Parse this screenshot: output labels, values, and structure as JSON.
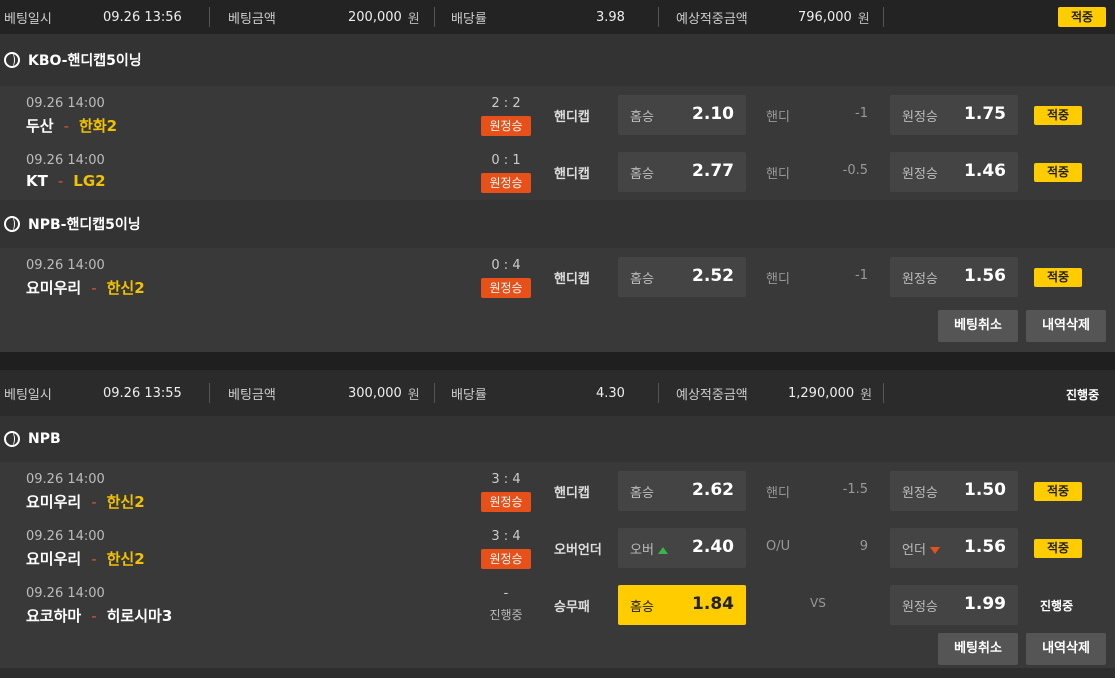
{
  "slip1": {
    "header": {
      "date_label": "베팅일시",
      "date": "09.26 13:56",
      "amount_label": "베팅금액",
      "amount": "200,000",
      "unit": "원",
      "odds_label": "배당률",
      "odds": "3.98",
      "expected_label": "예상적중금액",
      "expected": "796,000",
      "status": "적중"
    },
    "leagues": [
      {
        "name": "KBO-핸디캡5이닝",
        "games": [
          {
            "time": "09.26 14:00",
            "home": "두산",
            "away": "한화2",
            "score": "2 : 2",
            "badge": "원정승",
            "market": "핸디캡",
            "b1_label": "홈승",
            "b1_odds": "2.10",
            "mid_label": "핸디",
            "mid_val": "-1",
            "b3_label": "원정승",
            "b3_odds": "1.75",
            "result": "적중"
          },
          {
            "time": "09.26 14:00",
            "home": "KT",
            "away": "LG2",
            "score": "0 : 1",
            "badge": "원정승",
            "market": "핸디캡",
            "b1_label": "홈승",
            "b1_odds": "2.77",
            "mid_label": "핸디",
            "mid_val": "-0.5",
            "b3_label": "원정승",
            "b3_odds": "1.46",
            "result": "적중"
          }
        ]
      },
      {
        "name": "NPB-핸디캡5이닝",
        "games": [
          {
            "time": "09.26 14:00",
            "home": "요미우리",
            "away": "한신2",
            "score": "0 : 4",
            "badge": "원정승",
            "market": "핸디캡",
            "b1_label": "홈승",
            "b1_odds": "2.52",
            "mid_label": "핸디",
            "mid_val": "-1",
            "b3_label": "원정승",
            "b3_odds": "1.56",
            "result": "적중"
          }
        ]
      }
    ],
    "cancel_btn": "베팅취소",
    "delete_btn": "내역삭제"
  },
  "slip2": {
    "header": {
      "date_label": "베팅일시",
      "date": "09.26 13:55",
      "amount_label": "베팅금액",
      "amount": "300,000",
      "unit": "원",
      "odds_label": "배당률",
      "odds": "4.30",
      "expected_label": "예상적중금액",
      "expected": "1,290,000",
      "status": "진행중"
    },
    "league": "NPB",
    "games": [
      {
        "time": "09.26 14:00",
        "home": "요미우리",
        "away": "한신2",
        "score": "3 : 4",
        "badge": "원정승",
        "market": "핸디캡",
        "b1_label": "홈승",
        "b1_odds": "2.62",
        "mid_label": "핸디",
        "mid_val": "-1.5",
        "b3_label": "원정승",
        "b3_odds": "1.50",
        "result": "적중"
      },
      {
        "time": "09.26 14:00",
        "home": "요미우리",
        "away": "한신2",
        "score": "3 : 4",
        "badge": "원정승",
        "market": "오버언더",
        "b1_label": "오버",
        "b1_odds": "2.40",
        "mid_label": "O/U",
        "mid_val": "9",
        "b3_label": "언더",
        "b3_odds": "1.56",
        "result": "적중"
      },
      {
        "time": "09.26 14:00",
        "home": "요코하마",
        "away": "히로시마3",
        "score": "-",
        "status": "진행중",
        "market": "승무패",
        "b1_label": "홈승",
        "b1_odds": "1.84",
        "mid_vs": "VS",
        "b3_label": "원정승",
        "b3_odds": "1.99",
        "result": "진행중"
      }
    ],
    "cancel_btn": "베팅취소",
    "delete_btn": "내역삭제"
  }
}
